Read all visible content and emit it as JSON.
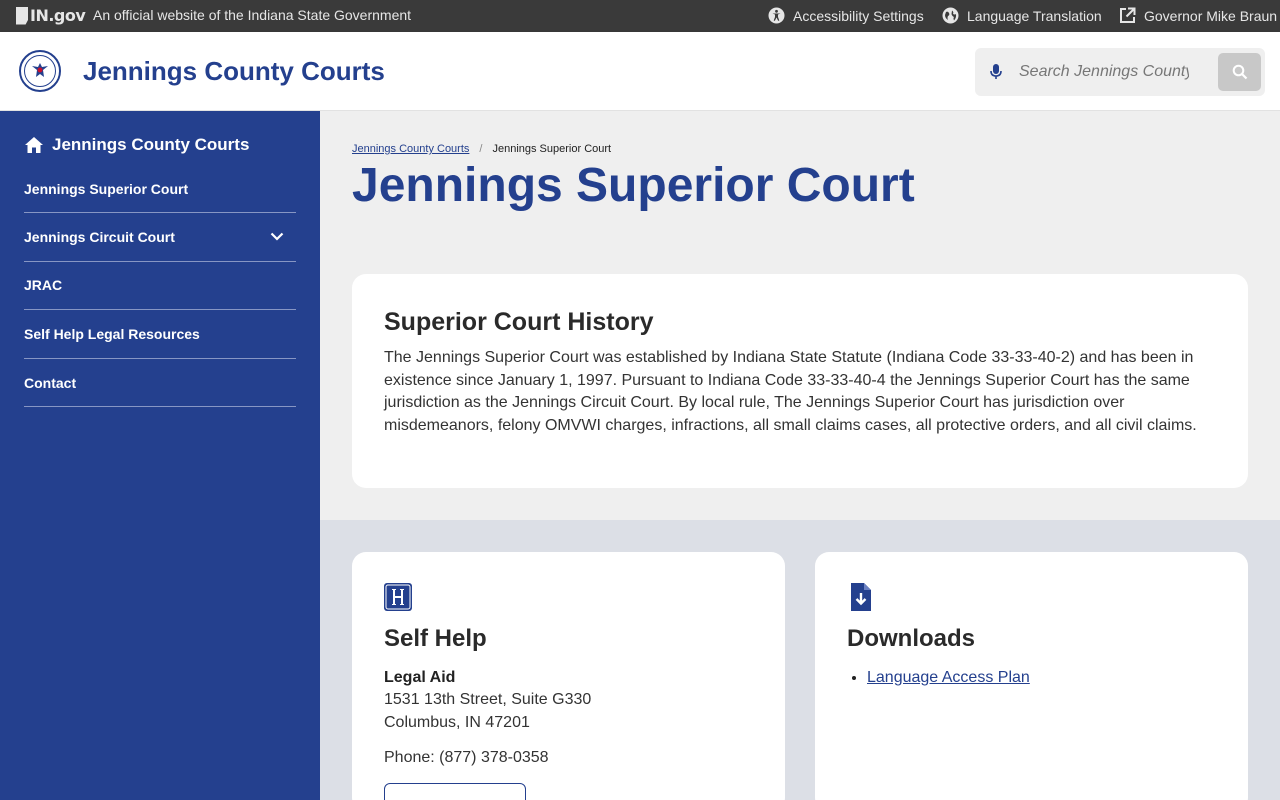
{
  "topbar": {
    "brand": "IN.gov",
    "official_text": "An official website of the Indiana State Government",
    "links": [
      {
        "label": "Accessibility Settings",
        "icon": "accessibility-icon"
      },
      {
        "label": "Language Translation",
        "icon": "globe-icon"
      },
      {
        "label": "Governor Mike Braun",
        "icon": "external-link-icon"
      }
    ]
  },
  "header": {
    "site_title": "Jennings County Courts",
    "search_placeholder": "Search Jennings County"
  },
  "sidebar": {
    "home_label": "Jennings County Courts",
    "items": [
      {
        "label": "Jennings Superior Court",
        "expandable": false
      },
      {
        "label": "Jennings Circuit Court",
        "expandable": true
      },
      {
        "label": "JRAC",
        "expandable": false
      },
      {
        "label": "Self Help Legal Resources",
        "expandable": false
      },
      {
        "label": "Contact",
        "expandable": false
      }
    ]
  },
  "breadcrumb": {
    "parent": "Jennings County Courts",
    "separator": "/",
    "current": "Jennings Superior Court"
  },
  "page": {
    "title": "Jennings Superior Court"
  },
  "history": {
    "heading": "Superior Court History",
    "body": "The Jennings Superior Court was established by Indiana State Statute (Indiana Code 33-33-40-2) and has been in existence since January 1, 1997. Pursuant to Indiana Code 33-33-40-4 the Jennings Superior Court has the same jurisdiction as the Jennings Circuit Court. By local rule, The Jennings Superior Court has jurisdiction over misdemeanors, felony OMVWI charges, infractions, all small claims cases, all protective orders, and all civil claims."
  },
  "self_help": {
    "heading": "Self Help",
    "org": "Legal Aid",
    "address_line1": "1531 13th Street, Suite G330",
    "address_line2": "Columbus, IN 47201",
    "phone": "Phone: (877) 378-0358"
  },
  "downloads": {
    "heading": "Downloads",
    "items": [
      "Language Access Plan"
    ]
  },
  "colors": {
    "brand_blue": "#24408e",
    "topbar": "#3a3a3a",
    "page_bg": "#efefef",
    "lower_bg": "#dcdfe6"
  }
}
